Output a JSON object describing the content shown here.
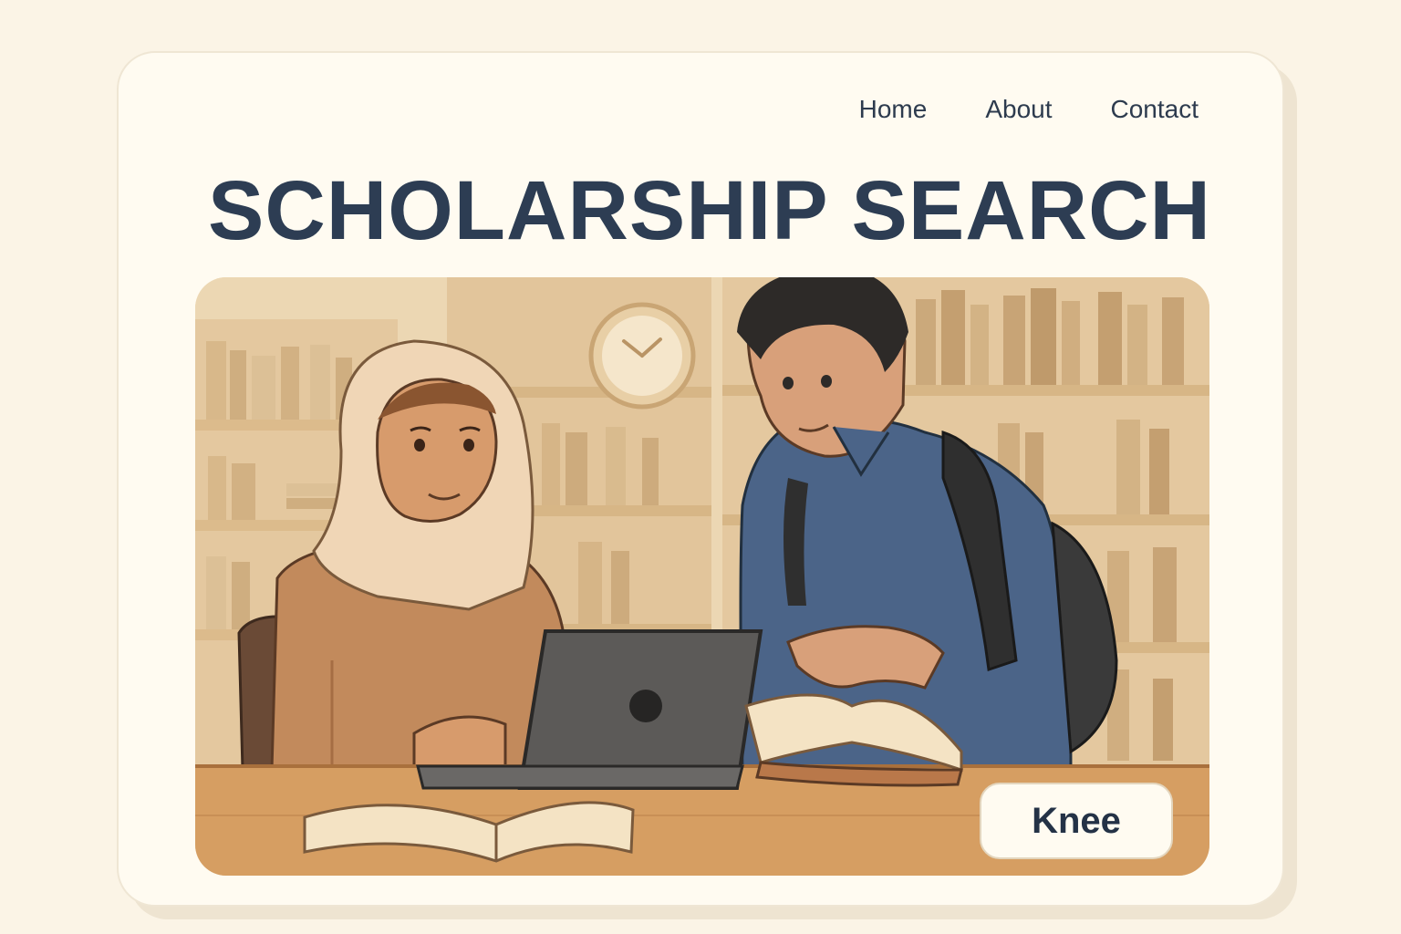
{
  "nav": {
    "items": [
      "Home",
      "About",
      "Contact"
    ]
  },
  "header": {
    "title": "SCHOLARSHIP SEARCH"
  },
  "hero": {
    "button_label": "Knee"
  },
  "colors": {
    "page_bg": "#fbf4e6",
    "card_bg": "#fffbf1",
    "title": "#2d3d53",
    "nav_text": "#2d3b4e"
  },
  "icons": [
    "clock-icon"
  ]
}
